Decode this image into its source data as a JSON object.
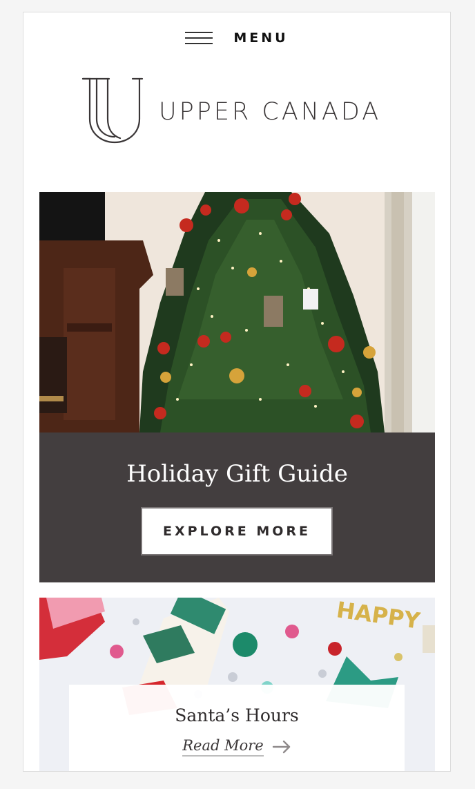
{
  "header": {
    "menu_label": "MENU",
    "hamburger_icon": "hamburger-icon",
    "logo_text": "UPPER CANADA"
  },
  "hero": {
    "title": "Holiday Gift Guide",
    "button_label": "EXPLORE MORE",
    "image": "christmas-tree-photo",
    "panel_color": "#433e3f"
  },
  "card2": {
    "title": "Santa’s Hours",
    "link_label": "Read More",
    "arrow_icon": "arrow-right-icon",
    "image": "holiday-party-decorations-photo"
  }
}
